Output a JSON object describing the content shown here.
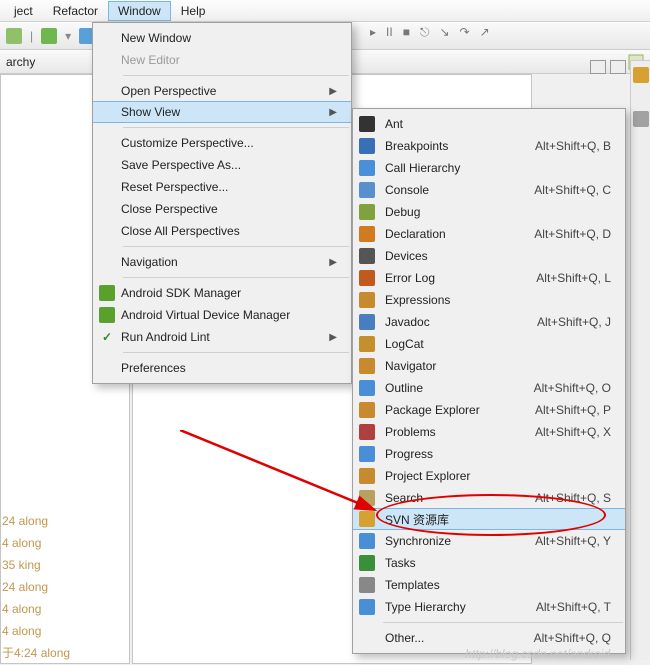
{
  "menubar": {
    "items": [
      "ject",
      "Refactor",
      "Window",
      "Help"
    ],
    "active_index": 2
  },
  "archy": {
    "label": "archy"
  },
  "window_menu": {
    "groups": [
      [
        {
          "label": "New Window",
          "disabled": false
        },
        {
          "label": "New Editor",
          "disabled": true
        }
      ],
      [
        {
          "label": "Open Perspective",
          "submenu": true
        },
        {
          "label": "Show View",
          "submenu": true,
          "hover": true
        }
      ],
      [
        {
          "label": "Customize Perspective..."
        },
        {
          "label": "Save Perspective As..."
        },
        {
          "label": "Reset Perspective..."
        },
        {
          "label": "Close Perspective"
        },
        {
          "label": "Close All Perspectives"
        }
      ],
      [
        {
          "label": "Navigation",
          "submenu": true
        }
      ],
      [
        {
          "label": "Android SDK Manager",
          "icon": "#5aa02c"
        },
        {
          "label": "Android Virtual Device Manager",
          "icon": "#5aa02c"
        },
        {
          "label": "Run Android Lint",
          "icon": "#2e8b2e",
          "submenu": true,
          "checkbox": true
        }
      ],
      [
        {
          "label": "Preferences"
        }
      ]
    ]
  },
  "show_view_menu": {
    "items": [
      {
        "label": "Ant",
        "icon": "#333333"
      },
      {
        "label": "Breakpoints",
        "icon": "#3a6fb7",
        "shortcut": "Alt+Shift+Q, B"
      },
      {
        "label": "Call Hierarchy",
        "icon": "#4a90d9"
      },
      {
        "label": "Console",
        "icon": "#5a8fce",
        "shortcut": "Alt+Shift+Q, C"
      },
      {
        "label": "Debug",
        "icon": "#7fa23e"
      },
      {
        "label": "Declaration",
        "icon": "#d07b1f",
        "shortcut": "Alt+Shift+Q, D"
      },
      {
        "label": "Devices",
        "icon": "#555555"
      },
      {
        "label": "Error Log",
        "icon": "#c05a1f",
        "shortcut": "Alt+Shift+Q, L"
      },
      {
        "label": "Expressions",
        "icon": "#c78a2e"
      },
      {
        "label": "Javadoc",
        "icon": "#4a7dbf",
        "shortcut": "Alt+Shift+Q, J"
      },
      {
        "label": "LogCat",
        "icon": "#c4902e"
      },
      {
        "label": "Navigator",
        "icon": "#c78a2e"
      },
      {
        "label": "Outline",
        "icon": "#4a8fd6",
        "shortcut": "Alt+Shift+Q, O"
      },
      {
        "label": "Package Explorer",
        "icon": "#c78a2e",
        "shortcut": "Alt+Shift+Q, P"
      },
      {
        "label": "Problems",
        "icon": "#b04040",
        "shortcut": "Alt+Shift+Q, X"
      },
      {
        "label": "Progress",
        "icon": "#4a8fd6"
      },
      {
        "label": "Project Explorer",
        "icon": "#c78a2e"
      },
      {
        "label": "Search",
        "icon": "#b8a060",
        "shortcut": "Alt+Shift+Q, S"
      },
      {
        "label": "SVN 资源库",
        "icon": "#d8a030",
        "hover": true
      },
      {
        "label": "Synchronize",
        "icon": "#4a8fd6",
        "shortcut": "Alt+Shift+Q, Y"
      },
      {
        "label": "Tasks",
        "icon": "#3a8f3a"
      },
      {
        "label": "Templates",
        "icon": "#888888"
      },
      {
        "label": "Type Hierarchy",
        "icon": "#4a8fd6",
        "shortcut": "Alt+Shift+Q, T"
      }
    ],
    "other": {
      "label": "Other...",
      "shortcut": "Alt+Shift+Q, Q"
    }
  },
  "left_log": {
    "lines": [
      "24  along",
      "4  along",
      "35  king",
      "24  along",
      "4  along",
      "4  along",
      "于4:24  along"
    ]
  },
  "watermark": "http://blog.csdn.net/android"
}
